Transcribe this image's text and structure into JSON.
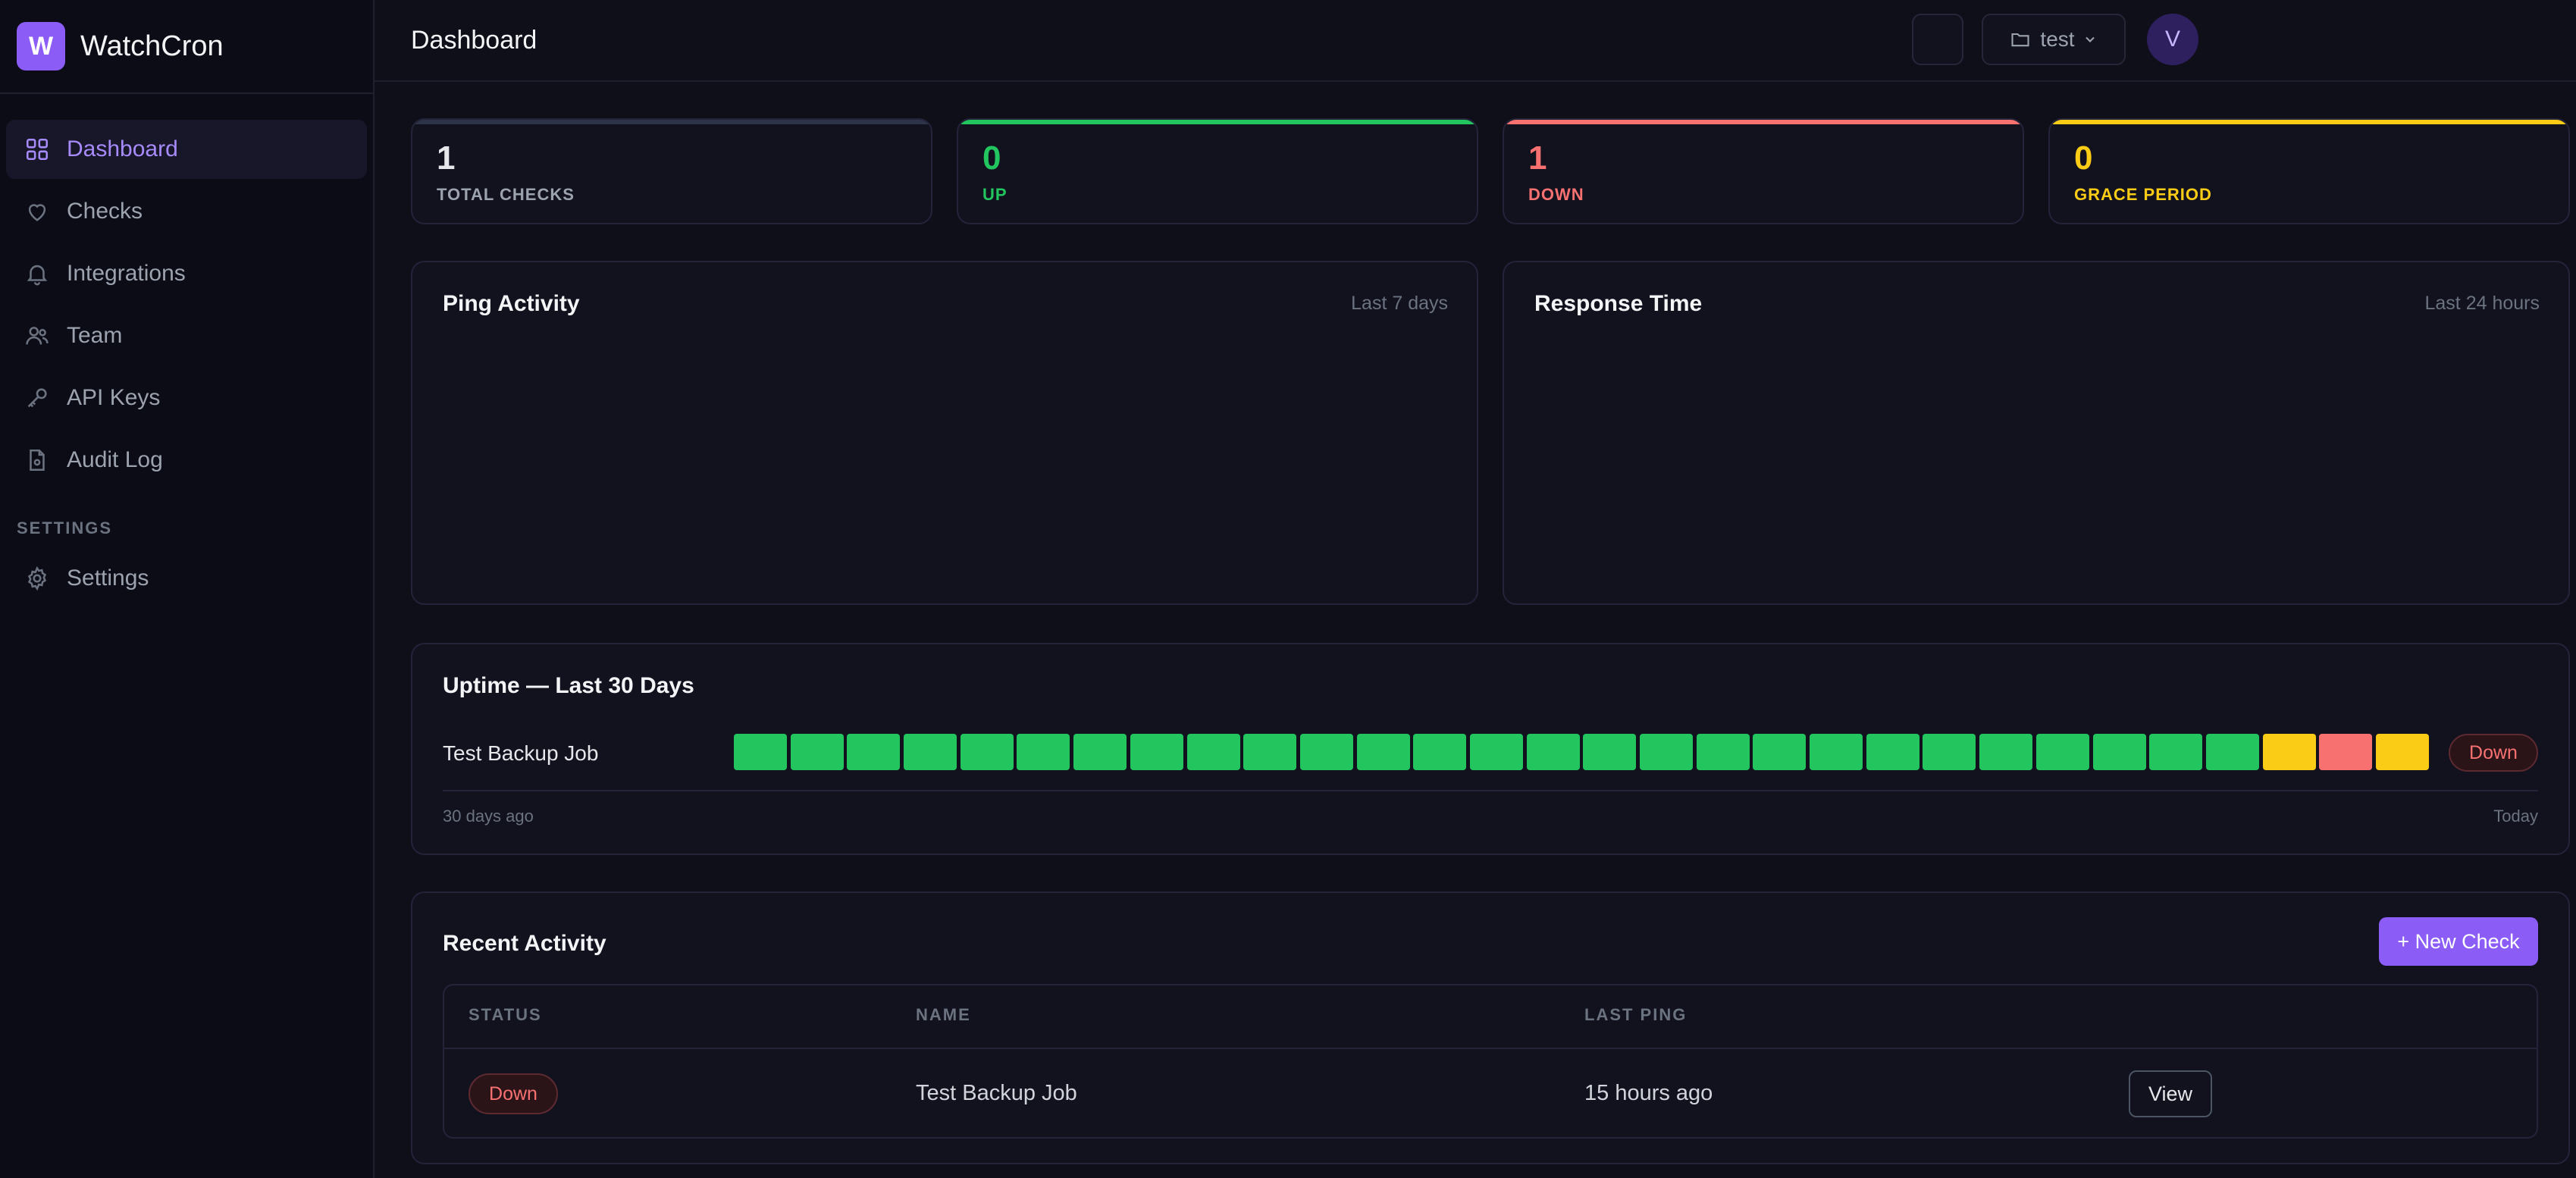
{
  "app": {
    "logo_letter": "W",
    "name": "WatchCron"
  },
  "sidebar": {
    "items": [
      {
        "label": "Dashboard",
        "icon": "grid-icon",
        "active": true
      },
      {
        "label": "Checks",
        "icon": "heart-icon"
      },
      {
        "label": "Integrations",
        "icon": "bell-icon"
      },
      {
        "label": "Team",
        "icon": "users-icon"
      },
      {
        "label": "API Keys",
        "icon": "key-icon"
      },
      {
        "label": "Audit Log",
        "icon": "file-icon"
      }
    ],
    "settings_section": "SETTINGS",
    "settings_item": {
      "label": "Settings",
      "icon": "gear-icon"
    }
  },
  "header": {
    "title": "Dashboard",
    "project": "test",
    "avatar_letter": "V"
  },
  "stats": [
    {
      "value": "1",
      "label": "TOTAL CHECKS",
      "color": "#e5e7eb",
      "label_color": "#9ca3af",
      "bar": "#2d3348"
    },
    {
      "value": "0",
      "label": "UP",
      "color": "#22c55e",
      "label_color": "#22c55e",
      "bar": "#22c55e"
    },
    {
      "value": "1",
      "label": "DOWN",
      "color": "#f87171",
      "label_color": "#f87171",
      "bar": "#f87171"
    },
    {
      "value": "0",
      "label": "GRACE PERIOD",
      "color": "#facc15",
      "label_color": "#facc15",
      "bar": "#facc15"
    }
  ],
  "ping_activity": {
    "title": "Ping Activity",
    "range": "Last 7 days"
  },
  "response_time": {
    "title": "Response Time",
    "range": "Last 24 hours"
  },
  "uptime": {
    "title": "Uptime — Last 30 Days",
    "job": "Test Backup Job",
    "days": [
      "up",
      "up",
      "up",
      "up",
      "up",
      "up",
      "up",
      "up",
      "up",
      "up",
      "up",
      "up",
      "up",
      "up",
      "up",
      "up",
      "up",
      "up",
      "up",
      "up",
      "up",
      "up",
      "up",
      "up",
      "up",
      "up",
      "up",
      "grace",
      "down",
      "grace"
    ],
    "status": "Down",
    "start_label": "30 days ago",
    "end_label": "Today",
    "colors": {
      "up": "#22c55e",
      "grace": "#facc15",
      "down": "#f87171"
    }
  },
  "activity": {
    "title": "Recent Activity",
    "new_check": "+ New Check",
    "columns": [
      "STATUS",
      "NAME",
      "LAST PING"
    ],
    "rows": [
      {
        "status": "Down",
        "name": "Test Backup Job",
        "last_ping": "15 hours ago",
        "action": "View"
      }
    ]
  }
}
